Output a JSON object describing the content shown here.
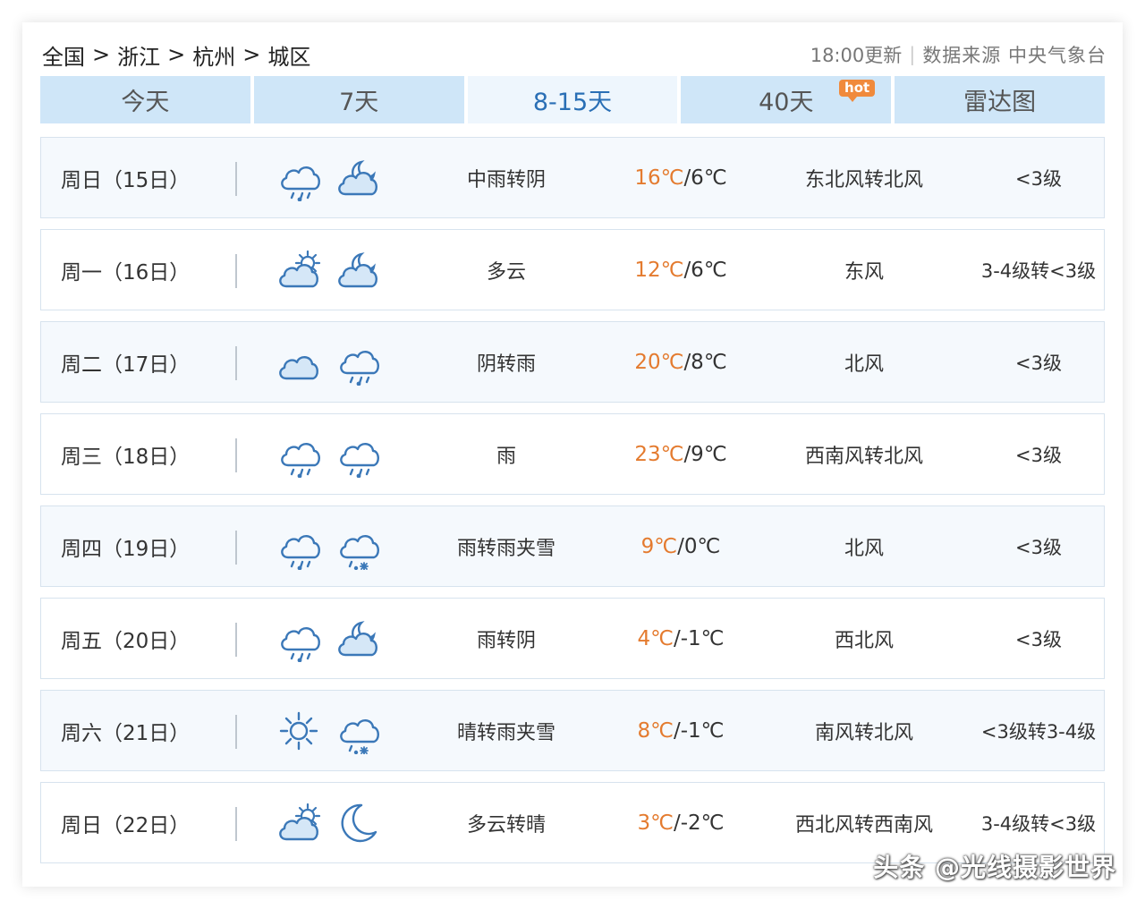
{
  "breadcrumb": [
    "全国",
    "浙江",
    "杭州",
    "城区"
  ],
  "breadcrumb_sep": ">",
  "meta": {
    "update": "18:00更新",
    "source": "数据来源 中央气象台"
  },
  "tabs": [
    {
      "label": "今天"
    },
    {
      "label": "7天"
    },
    {
      "label": "8-15天"
    },
    {
      "label": "40天",
      "badge": "hot"
    },
    {
      "label": "雷达图"
    }
  ],
  "colors": {
    "accent": "#2a6fb5",
    "high_temp": "#e47b2f",
    "tab_bg": "#cfe6f8",
    "row_bg": "#f5f9fd"
  },
  "days": [
    {
      "date": "周日（15日）",
      "icons": [
        "rain-cloud-icon",
        "cloudy-night-icon"
      ],
      "desc": "中雨转阴",
      "high": "16℃",
      "low": "/6℃",
      "wind": "东北风转北风",
      "level": "<3级"
    },
    {
      "date": "周一（16日）",
      "icons": [
        "partly-cloudy-day-icon",
        "cloudy-night-icon"
      ],
      "desc": "多云",
      "high": "12℃",
      "low": "/6℃",
      "wind": "东风",
      "level": "3-4级转<3级"
    },
    {
      "date": "周二（17日）",
      "icons": [
        "overcast-icon",
        "rain-cloud-icon"
      ],
      "desc": "阴转雨",
      "high": "20℃",
      "low": "/8℃",
      "wind": "北风",
      "level": "<3级"
    },
    {
      "date": "周三（18日）",
      "icons": [
        "rain-cloud-icon",
        "rain-cloud-icon"
      ],
      "desc": "雨",
      "high": "23℃",
      "low": "/9℃",
      "wind": "西南风转北风",
      "level": "<3级"
    },
    {
      "date": "周四（19日）",
      "icons": [
        "rain-cloud-icon",
        "sleet-icon"
      ],
      "desc": "雨转雨夹雪",
      "high": "9℃",
      "low": "/0℃",
      "wind": "北风",
      "level": "<3级"
    },
    {
      "date": "周五（20日）",
      "icons": [
        "rain-cloud-icon",
        "cloudy-night-icon"
      ],
      "desc": "雨转阴",
      "high": "4℃",
      "low": "/-1℃",
      "wind": "西北风",
      "level": "<3级"
    },
    {
      "date": "周六（21日）",
      "icons": [
        "sun-icon",
        "sleet-icon"
      ],
      "desc": "晴转雨夹雪",
      "high": "8℃",
      "low": "/-1℃",
      "wind": "南风转北风",
      "level": "<3级转3-4级"
    },
    {
      "date": "周日（22日）",
      "icons": [
        "partly-cloudy-day-icon",
        "moon-icon"
      ],
      "desc": "多云转晴",
      "high": "3℃",
      "low": "/-2℃",
      "wind": "西北风转西南风",
      "level": "3-4级转<3级"
    }
  ],
  "watermark": "头条 @光线摄影世界"
}
